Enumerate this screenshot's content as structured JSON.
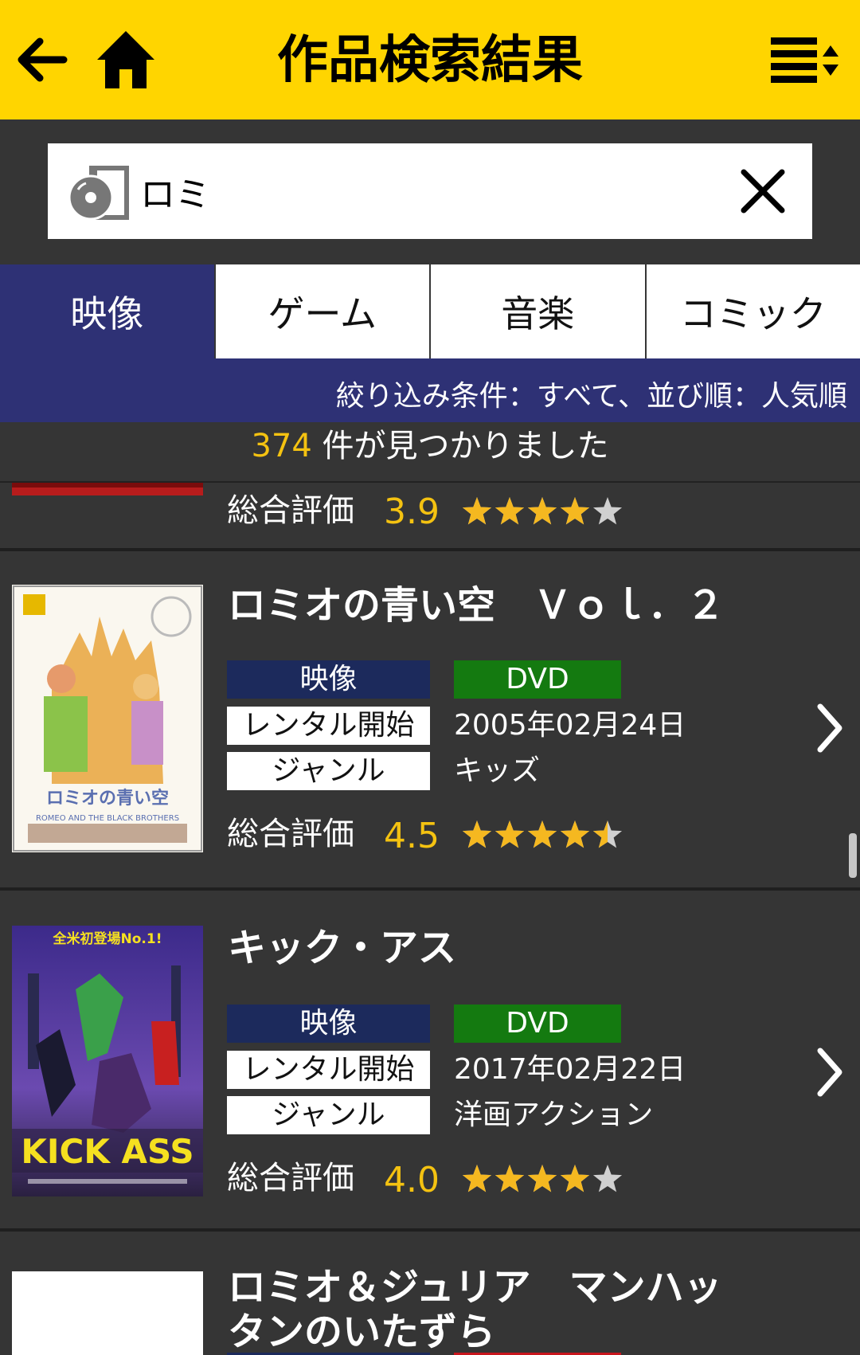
{
  "header": {
    "title": "作品検索結果",
    "back_icon": "arrow-left-icon",
    "home_icon": "home-icon",
    "menu_icon": "sort-menu-icon",
    "background_color": "#ffd500"
  },
  "search": {
    "value": "ロミ",
    "placeholder": "",
    "type_icon": "disc-icon",
    "clear_icon": "close-icon"
  },
  "tabs": [
    {
      "label": "映像",
      "active": true
    },
    {
      "label": "ゲーム",
      "active": false
    },
    {
      "label": "音楽",
      "active": false
    },
    {
      "label": "コミック",
      "active": false
    }
  ],
  "filter": {
    "text": "絞り込み条件：すべて、並び順：人気順"
  },
  "results": {
    "count": "374",
    "count_suffix": " 件が見つかりました"
  },
  "items": [
    {
      "title": "",
      "rating_label": "総合評価",
      "rating": "3.9",
      "rating_value": 3.9
    },
    {
      "title": "ロミオの青い空　Ｖｏｌ．２",
      "category": "映像",
      "format": "DVD",
      "rental_label": "レンタル開始",
      "rental_date": "2005年02月24日",
      "genre_label": "ジャンル",
      "genre": "キッズ",
      "rating_label": "総合評価",
      "rating": "4.5",
      "rating_value": 4.5,
      "cover_text": "ロミオの青い空",
      "cover_subtext": "ROMEO AND THE BLACK BROTHERS"
    },
    {
      "title": "キック・アス",
      "category": "映像",
      "format": "DVD",
      "rental_label": "レンタル開始",
      "rental_date": "2017年02月22日",
      "genre_label": "ジャンル",
      "genre": "洋画アクション",
      "rating_label": "総合評価",
      "rating": "4.0",
      "rating_value": 4.0,
      "cover_top": "全米初登場No.1!",
      "cover_title": "KICK ASS"
    },
    {
      "title": "ロミオ＆ジュリア　マンハッタンのいたずら"
    }
  ],
  "colors": {
    "accent_yellow": "#ffd500",
    "tab_active": "#2e3175",
    "category_badge": "#1c2a5c",
    "format_dvd": "#147a10",
    "format_red": "#c8161d",
    "star_on": "#f5b820",
    "star_off": "#d0d0d0",
    "count_number": "#f4c211"
  }
}
